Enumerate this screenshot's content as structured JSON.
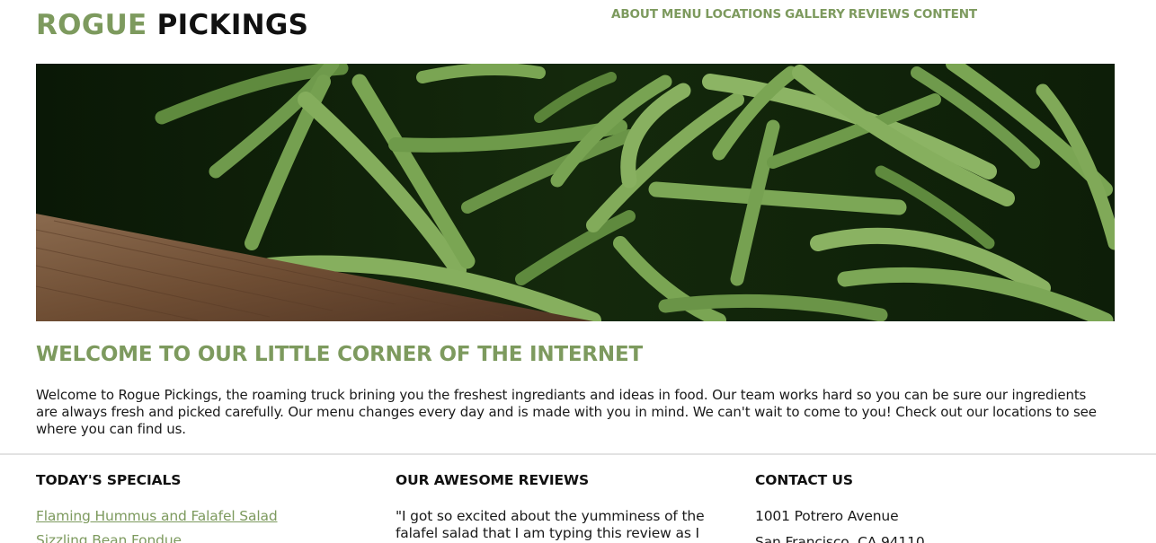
{
  "header": {
    "logo_part1": "ROGUE",
    "logo_part2": "PICKINGS",
    "nav": [
      "ABOUT",
      "MENU",
      "LOCATIONS",
      "GALLERY",
      "REVIEWS",
      "CONTENT"
    ]
  },
  "hero": {
    "image_alt_icon": "green-beans-photo-icon"
  },
  "welcome": {
    "title": "WELCOME TO OUR LITTLE CORNER OF THE INTERNET",
    "text": "Welcome to Rogue Pickings, the roaming truck brining you the freshest ingrediants and ideas in food. Our team works hard so you can be sure our ingredients are always fresh and picked carefully. Our menu changes every day and is made with you in mind. We can't wait to come to you! Check out our locations to see where you can find us."
  },
  "specials": {
    "heading": "TODAY'S SPECIALS",
    "items": [
      "Flaming Hummus and Falafel Salad",
      "Sizzling Bean Fondue"
    ]
  },
  "reviews": {
    "heading": "OUR AWESOME REVIEWS",
    "quote": "\"I got so excited about the yumminess of the falafel salad that I am typing this review as I"
  },
  "contact": {
    "heading": "CONTACT US",
    "lines": [
      "1001 Potrero Avenue",
      "San Francisco, CA 94110"
    ]
  },
  "colors": {
    "accent": "#7d9a5e",
    "text": "#1a1a1a",
    "divider": "#e2e2e2"
  }
}
